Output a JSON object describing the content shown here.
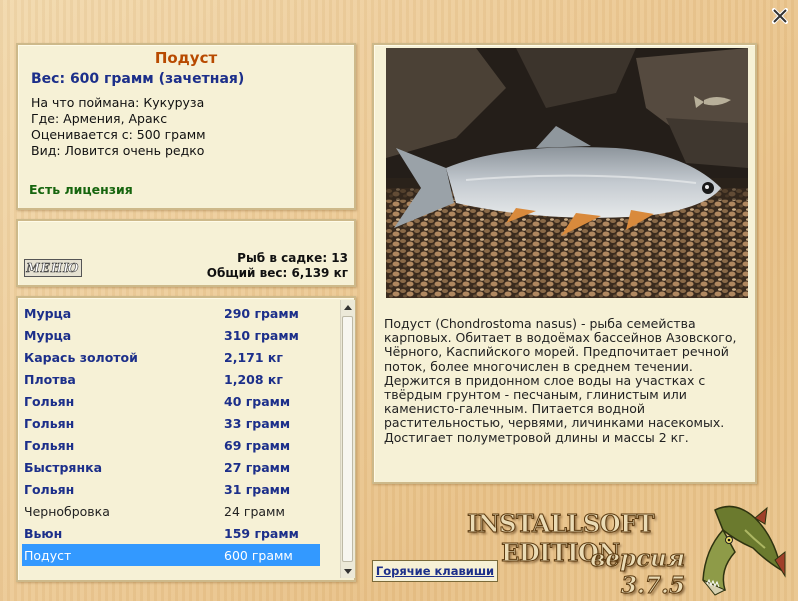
{
  "info": {
    "title": "Подуст",
    "weight": "Вес: 600 грамм (зачетная)",
    "caught_on": "На что поймана: Кукуруза",
    "where": "Где: Армения, Аракс",
    "rated_from": "Оценивается с: 500 грамм",
    "kind": "Вид: Ловится очень редко",
    "license": "Есть лицензия"
  },
  "cage": {
    "menu_label": "МЕНЮ",
    "fish_count": "Рыб в садке: 13",
    "total_weight": "Общий вес: 6,139 кг"
  },
  "catch_list": [
    {
      "name": "Мурца",
      "weight": "290 грамм",
      "style": "hl"
    },
    {
      "name": "Мурца",
      "weight": "310 грамм",
      "style": "hl"
    },
    {
      "name": "Карась золотой",
      "weight": "2,171 кг",
      "style": "hl"
    },
    {
      "name": "Плотва",
      "weight": "1,208 кг",
      "style": "hl"
    },
    {
      "name": "Гольян",
      "weight": "40 грамм",
      "style": "hl"
    },
    {
      "name": "Гольян",
      "weight": "33 грамм",
      "style": "hl"
    },
    {
      "name": "Гольян",
      "weight": "69 грамм",
      "style": "hl"
    },
    {
      "name": "Быстрянка",
      "weight": "27 грамм",
      "style": "hl"
    },
    {
      "name": "Гольян",
      "weight": "31 грамм",
      "style": "hl"
    },
    {
      "name": "Чернобровка",
      "weight": "24 грамм",
      "style": "plain"
    },
    {
      "name": "Вьюн",
      "weight": "159 грамм",
      "style": "hl"
    },
    {
      "name": "Подуст",
      "weight": "600 грамм",
      "style": "sel"
    }
  ],
  "description": "Подуст (Chondrostoma nasus) - рыба семейства карповых. Обитает в водоёмах бассейнов Азовского, Чёрного, Каспийского морей. Предпочитает речной поток, более многочислен в среднем течении. Держится в придонном слое воды на участках с твёрдым грунтом - песчаным, глинистым или каменисто-галечным. Питается водной растительностью, червями, личинками насекомых. Достигает полуметровой длины и массы 2 кг.",
  "hotkeys_label": "Горячие клавиши",
  "brand": {
    "edition": "INSTALLSOFT EDITION",
    "version": "версия 3.7.5"
  },
  "icons": {
    "close": "close-icon",
    "scroll_up": "arrow-up-icon",
    "scroll_down": "arrow-down-icon",
    "pike": "pike-logo-icon"
  },
  "colors": {
    "selection": "#3399ff",
    "title": "#b84a00",
    "bold_text": "#1c2f8a",
    "license": "#16650e"
  }
}
